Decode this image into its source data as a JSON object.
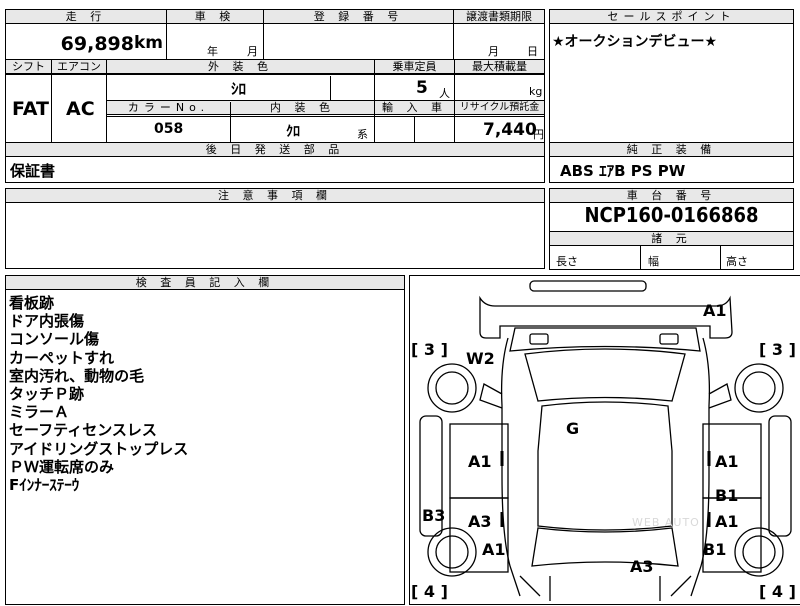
{
  "top": {
    "mileage_label": "走 行",
    "mileage_value": "69,898",
    "mileage_unit": "km",
    "inspection_label": "車 検",
    "inspection_year_unit": "年",
    "inspection_month_unit": "月",
    "registration_label": "登 録 番 号",
    "transfer_label": "譲渡書類期限",
    "transfer_month_unit": "月",
    "transfer_day_unit": "日",
    "sales_label": "セールスポイント",
    "sales_text": "★オークションデビュー★"
  },
  "spec": {
    "shift_label": "シフト",
    "shift_value": "FAT",
    "ac_label": "エアコン",
    "ac_value": "AC",
    "exterior_label": "外 装 色",
    "exterior_value": "ｼﾛ",
    "capacity_label": "乗車定員",
    "capacity_value": "5",
    "capacity_unit": "人",
    "maxload_label": "最大積載量",
    "maxload_unit": "kg",
    "colorno_label": "カラーNo.",
    "colorno_value": "058",
    "interior_label": "内 装 色",
    "interior_value": "ｸﾛ",
    "interior_suffix": "系",
    "import_label": "輸 入 車",
    "recycle_label": "リサイクル預託金",
    "recycle_value": "7,440",
    "recycle_unit": "円"
  },
  "later": {
    "label": "後 日 発 送 部 品",
    "value": "保証書"
  },
  "equipment": {
    "label": "純 正 装 備",
    "value": "ABS ｴｱB PS PW"
  },
  "caution": {
    "label": "注 意 事 項 欄"
  },
  "chassis": {
    "label": "車 台 番 号",
    "value": "NCP160-0166868",
    "dims_label": "諸 元",
    "length_label": "長さ",
    "width_label": "幅",
    "height_label": "高さ"
  },
  "inspector": {
    "label": "検 査 員 記 入 欄",
    "notes": [
      "看板跡",
      "ドア内張傷",
      "コンソール傷",
      "カーペットすれ",
      "室内汚れ、動物の毛",
      "タッチＰ跡",
      "ミラーＡ",
      "セーフティセンスレス",
      "アイドリングストップレス",
      "ＰＷ運転席のみ",
      "Fｲﾝﾅｰｽﾃｰｳ"
    ]
  },
  "diagram": {
    "bracket_left_top": "[ 3 ]",
    "bracket_right_top": "[ 3 ]",
    "bracket_left_bottom": "[ 4 ]",
    "bracket_right_bottom": "[ 4 ]",
    "marks": {
      "front_bumper": "A1",
      "windshield": "W2",
      "roof": "G",
      "front_left_door": "A1",
      "front_right_door": "A1",
      "rear_left_door": "A3",
      "rear_right_door_a": "B1",
      "rear_right_door_b": "A1",
      "left_sill": "B3",
      "rear_left_fender": "A1",
      "rear_right_fender": "B1",
      "rear": "A3"
    },
    "watermark": "WEB AUTO"
  }
}
